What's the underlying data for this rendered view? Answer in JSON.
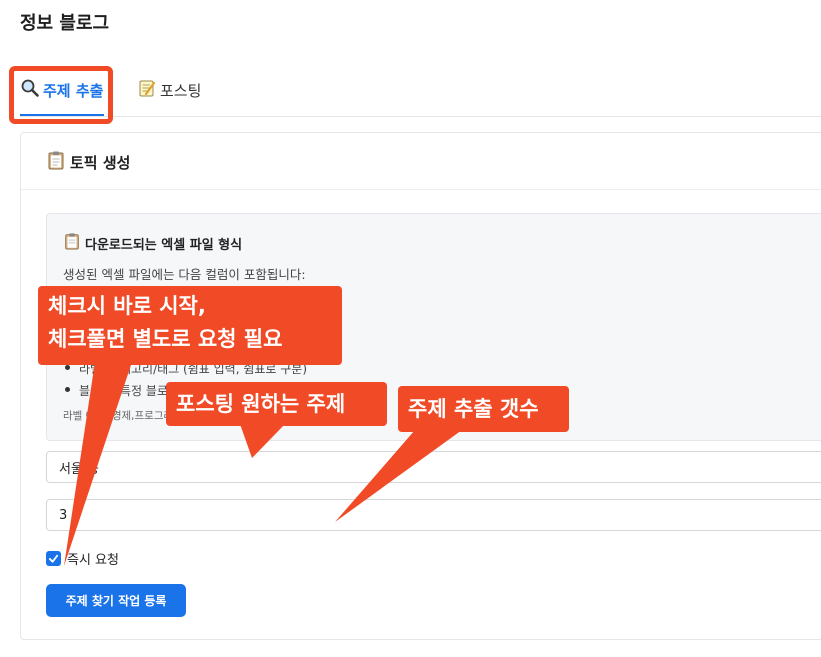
{
  "app": {
    "title": "정보 블로그"
  },
  "tabs": [
    {
      "label": "주제 추출",
      "icon": "magnifier-icon",
      "active": true
    },
    {
      "label": "포스팅",
      "icon": "memo-icon",
      "active": false
    }
  ],
  "panel": {
    "title": "토픽 생성",
    "info_box": {
      "title": "다운로드되는 엑셀 파일 형식",
      "description": "생성된 엑셀 파일에는 다음 컬럼이 포함됩니다:",
      "bullets": [
        "라벨: 카테고리/태그 (쉼표 입력, 쉼표로 구분)",
        "블로거: 특정 블로거 지정 (필요한 경우 사용)"
      ],
      "example": "라벨 예시: 경제,프로그래밍,여행"
    },
    "topic_input": {
      "value": "서울 등"
    },
    "count_input": {
      "value": "3"
    },
    "immediate_checkbox": {
      "label": "즉시 요청",
      "checked": true
    },
    "submit_button": {
      "label": "주제 찾기 작업 등록"
    }
  },
  "annotations": {
    "checkbox_note": [
      "체크시 바로 시작,",
      "체크풀면 별도로 요청 필요"
    ],
    "topic_note": "포스팅 원하는 주제",
    "count_note": "주제 추출 갯수"
  },
  "colors": {
    "accent": "#1a73e8",
    "annotation": "#f04a26"
  }
}
